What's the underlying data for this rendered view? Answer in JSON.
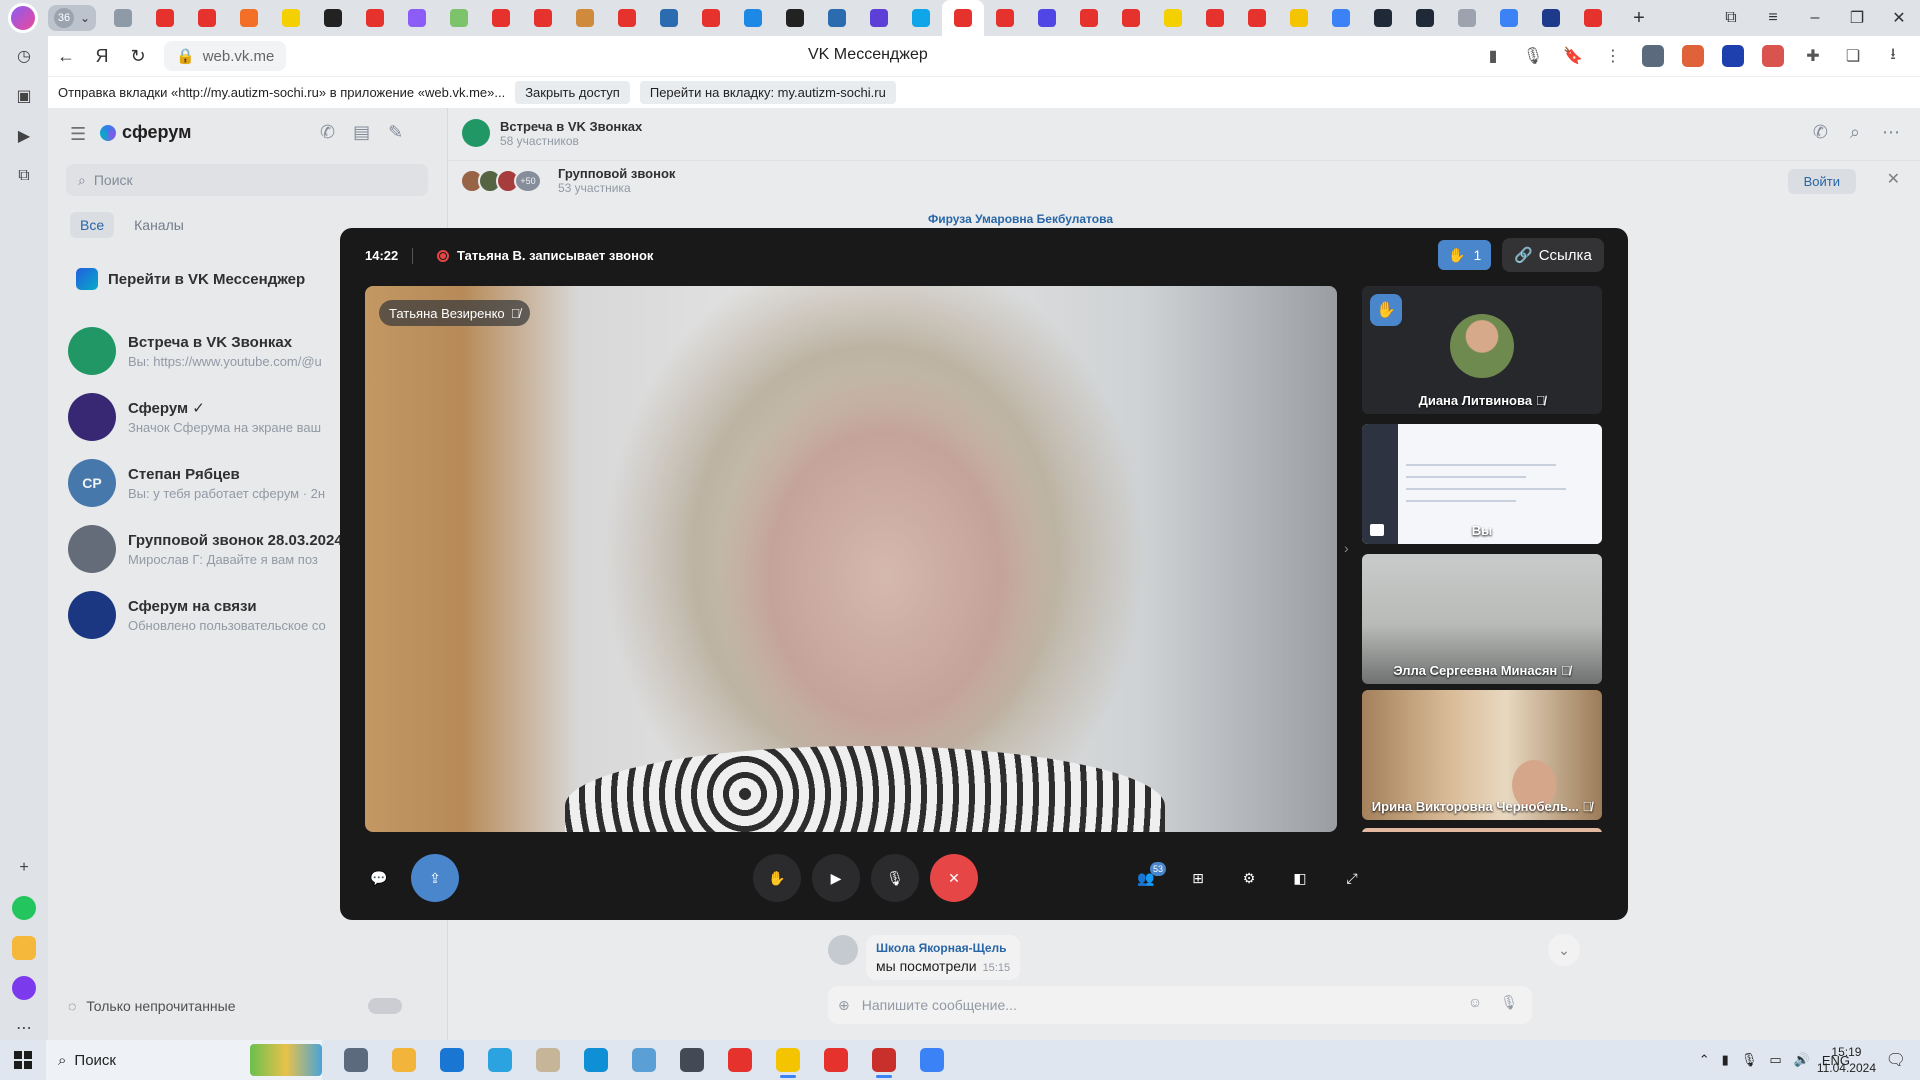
{
  "browser": {
    "tab_count": "36",
    "url": "web.vk.me",
    "page_title": "VK Мессенджер",
    "infobar_text": "Отправка вкладки «http://my.autizm-sochi.ru» в приложение «web.vk.me»...",
    "infobar_close": "Закрыть доступ",
    "infobar_goto": "Перейти на вкладку: my.autizm-sochi.ru",
    "tab_colors": [
      "#8e9aa8",
      "#e5322d",
      "#e5322d",
      "#f36f27",
      "#f5d000",
      "#222222",
      "#e5322d",
      "#8b5cf6",
      "#7cc36c",
      "#e5322d",
      "#e5322d",
      "#d08a3c",
      "#e5322d",
      "#2b6cb0",
      "#e5322d",
      "#1e88e5",
      "#222222",
      "#2b6cb0",
      "#5b3fd6",
      "#0ea5e9",
      "#e5322d",
      "#e5322d",
      "#4f46e5",
      "#e5322d",
      "#e5322d",
      "#f5d000",
      "#e5322d",
      "#e5322d",
      "#f5c400",
      "#3b82f6",
      "#1f2937",
      "#1f2937",
      "#9ca3af",
      "#3b82f6",
      "#1e3a8a",
      "#e5322d"
    ]
  },
  "sidebar": {
    "brand": "сферум",
    "search_placeholder": "Поиск",
    "filter_all": "Все",
    "filter_channels": "Каналы",
    "goto_vk": "Перейти в VK Мессенджер",
    "chats": [
      {
        "name": "Встреча в VK Звонках",
        "preview": "Вы: https://www.youtube.com/@u",
        "color": "#22a06b",
        "initials": ""
      },
      {
        "name": "Сферум ✓",
        "preview": "Значок Сферума на экране ваш",
        "color": "#3b2a7a",
        "initials": ""
      },
      {
        "name": "Степан Рябцев",
        "preview": "Вы: у тебя работает сферум · 2н",
        "color": "#4a7fb5",
        "initials": "СР"
      },
      {
        "name": "Групповой звонок 28.03.2024",
        "preview": "Мирослав Г: Давайте я вам поз",
        "color": "#6b7280",
        "initials": ""
      },
      {
        "name": "Сферум на связи",
        "preview": "Обновлено пользовательское со",
        "color": "#1e3a8a",
        "initials": ""
      }
    ],
    "unread_only": "Только непрочитанные"
  },
  "conversation": {
    "title": "Встреча в VK Звонках",
    "members": "58 участников",
    "call_title": "Групповой звонок",
    "call_members": "53 участника",
    "call_more": "+50",
    "join": "Войти",
    "top_sender": "Фируза Умаровна Бекбулатова",
    "msg_sender": "Школа Якорная-Щель",
    "msg_text": "мы посмотрели",
    "msg_time": "15:15",
    "composer_placeholder": "Напишите сообщение..."
  },
  "call": {
    "time": "14:22",
    "recording": "Татьяна В. записывает звонок",
    "hands": "1",
    "link": "Ссылка",
    "speaker": "Татьяна Везиренко",
    "participants": [
      {
        "name": "Диана Литвинова"
      },
      {
        "name": "Вы"
      },
      {
        "name": "Элла Сергеевна Минасян"
      },
      {
        "name": "Ирина Викторовна Чернобель..."
      }
    ],
    "participants_count": "53"
  },
  "taskbar": {
    "search": "Поиск",
    "lang": "ENG",
    "time": "15:19",
    "date": "11.04.2024",
    "app_colors": [
      "#5b6b7d",
      "#f2b43a",
      "#1976d2",
      "#2aa3e0",
      "#c7b59a",
      "#0f8fd6",
      "#5aa0d6",
      "#444a55",
      "#e5322d",
      "#f5c400",
      "#e5322d",
      "#c9302c",
      "#3b82f6"
    ]
  },
  "colors": {
    "accent": "#4986cc",
    "end_call": "#e64646",
    "modal_bg": "#19191a"
  }
}
